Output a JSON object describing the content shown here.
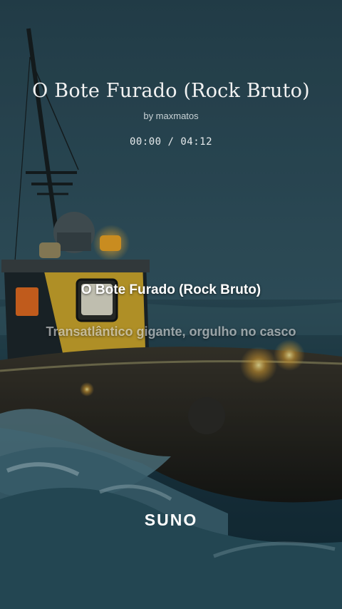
{
  "song": {
    "title": "O Bote Furado (Rock Bruto)",
    "byline": "by maxmatos",
    "time_display": "00:00 / 04:12"
  },
  "lyrics": {
    "current": "O Bote Furado (Rock Bruto)",
    "next": "Transatlântico gigante, orgulho no casco"
  },
  "brand": {
    "logo_text": "SUNO"
  },
  "colors": {
    "sky": "#2b4a56",
    "sea": "#183440",
    "cabin_yellow": "#d4a928",
    "light_amber": "#ffb733"
  }
}
